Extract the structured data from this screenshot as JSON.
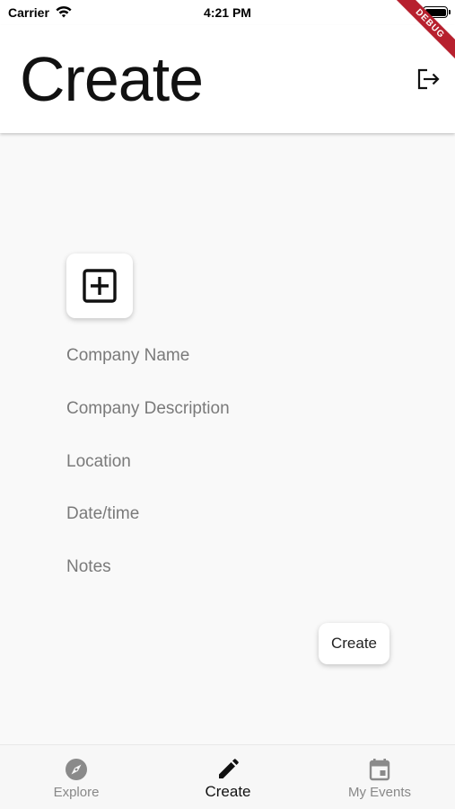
{
  "status_bar": {
    "carrier": "Carrier",
    "time": "4:21 PM"
  },
  "debug_banner": "DEBUG",
  "header": {
    "title": "Create",
    "logout_icon": "logout-icon"
  },
  "form": {
    "image_button_icon": "add-box-icon",
    "fields": {
      "company_name": {
        "placeholder": "Company Name",
        "value": ""
      },
      "company_description": {
        "placeholder": "Company Description",
        "value": ""
      },
      "location": {
        "placeholder": "Location",
        "value": ""
      },
      "datetime": {
        "placeholder": "Date/time",
        "value": ""
      },
      "notes": {
        "placeholder": "Notes",
        "value": ""
      }
    },
    "submit_label": "Create"
  },
  "bottom_nav": {
    "items": [
      {
        "label": "Explore",
        "icon": "compass-icon",
        "active": false
      },
      {
        "label": "Create",
        "icon": "pencil-icon",
        "active": true
      },
      {
        "label": "My Events",
        "icon": "calendar-icon",
        "active": false
      }
    ]
  },
  "colors": {
    "background": "#f9f9f9",
    "inactive_nav": "#888888",
    "active_nav": "#111111",
    "debug_ribbon": "#b7202e"
  }
}
